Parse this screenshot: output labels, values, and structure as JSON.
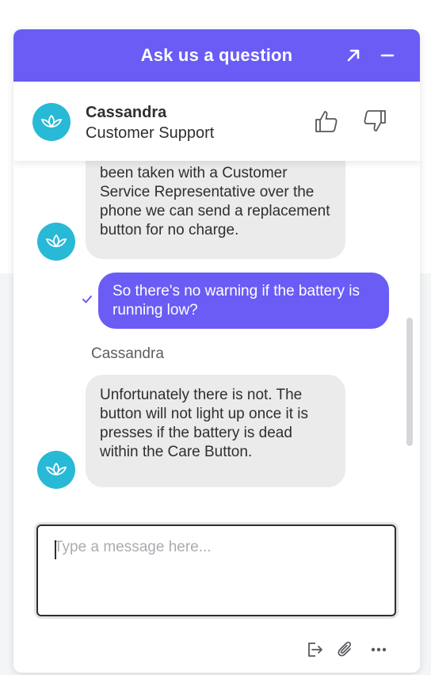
{
  "header": {
    "title": "Ask us a question",
    "expand_icon": "arrow-up-right-icon",
    "minimize_icon": "minus-icon"
  },
  "agent": {
    "name": "Cassandra",
    "role": "Customer Support",
    "avatar_icon": "lotus-icon",
    "thumbs_up_icon": "thumbs-up-icon",
    "thumbs_down_icon": "thumbs-down-icon"
  },
  "messages": [
    {
      "sender": "agent",
      "text": "been taken with a Customer Service Representative over the phone we can send a replacement button for no charge."
    },
    {
      "sender": "user",
      "text": "So there's no warning if the battery is running low?",
      "status_icon": "checkmark-icon"
    },
    {
      "sender": "agent",
      "sender_label": "Cassandra",
      "text": "Unfortunately there is not. The button will not light up once it is presses if the battery is dead within the Care Button."
    }
  ],
  "composer": {
    "placeholder": "Type a message here...",
    "value": ""
  },
  "toolbar": {
    "icons": [
      "exit-icon",
      "paperclip-icon",
      "more-icon"
    ]
  },
  "colors": {
    "brand": "#6a5cf5",
    "avatar": "#28b9d6",
    "agent_bubble": "#ebebeb",
    "text": "#2d2f33"
  }
}
